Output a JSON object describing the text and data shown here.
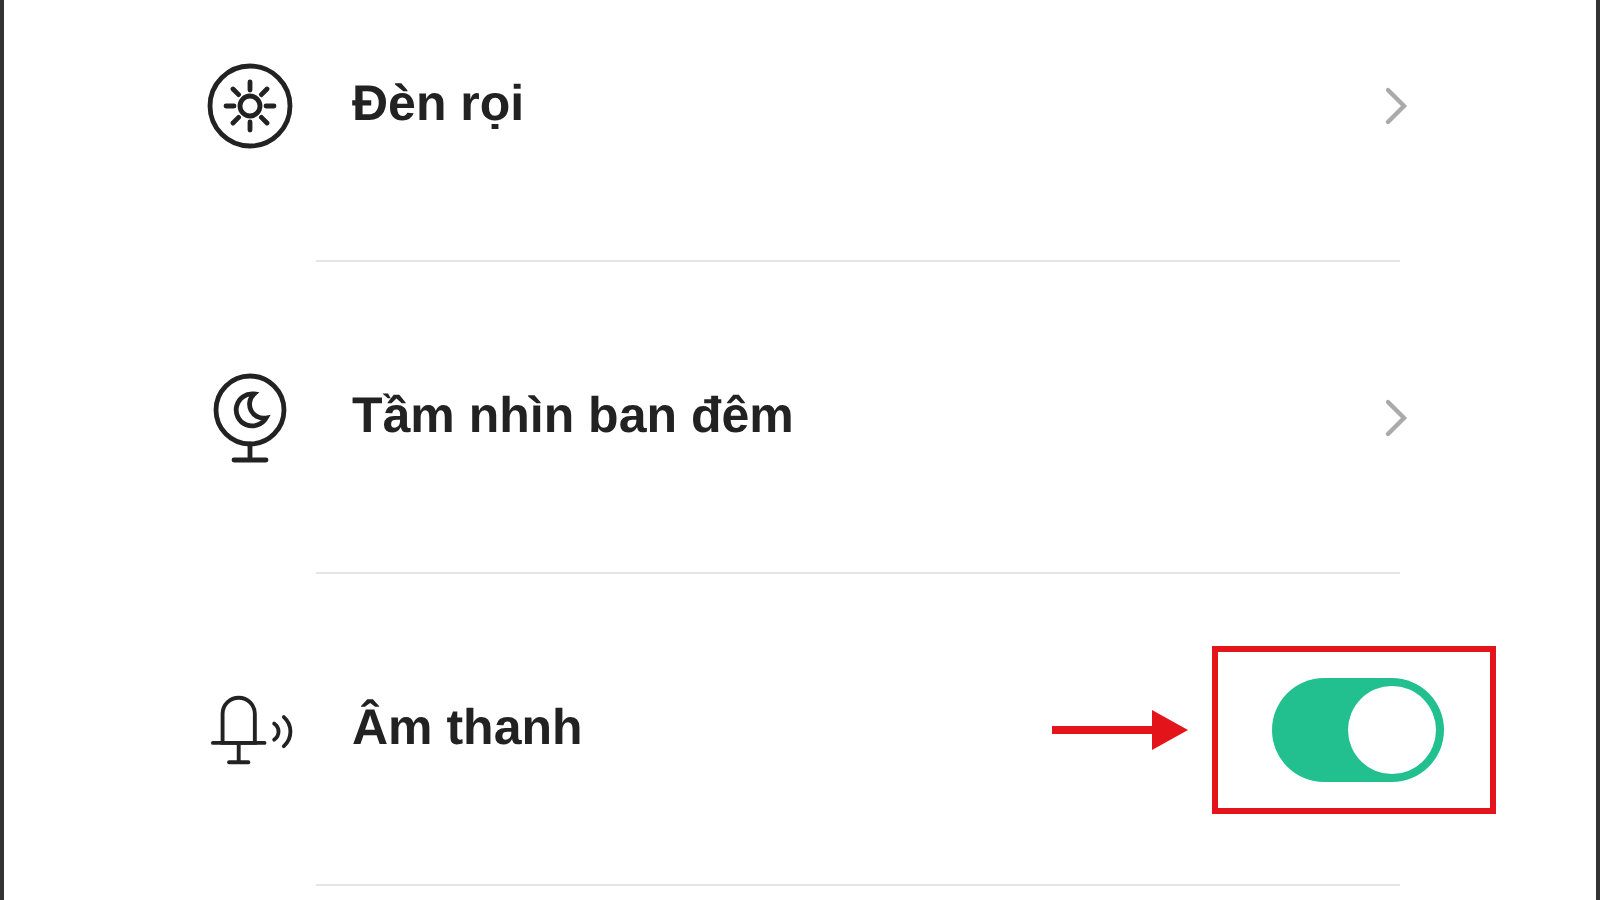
{
  "settings": [
    {
      "kind": "chevron",
      "label": "Đèn rọi"
    },
    {
      "kind": "chevron",
      "label": "Tầm nhìn ban đêm"
    },
    {
      "kind": "toggle",
      "label": "Âm thanh",
      "on": true
    }
  ]
}
